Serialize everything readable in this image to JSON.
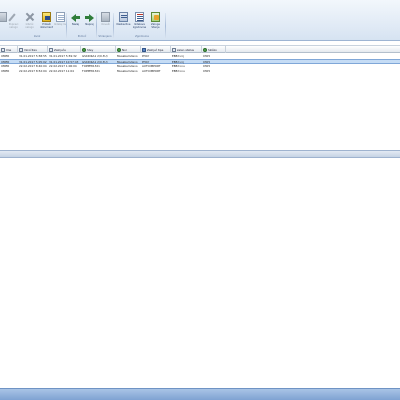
{
  "ribbon": {
    "buttons": [
      {
        "label": "",
        "icon": "edit-icon",
        "disabled": true
      },
      {
        "label": "Popravi nalogo",
        "icon": "pencil-icon",
        "disabled": true
      },
      {
        "label": "Izbriši nalogo",
        "icon": "delete-icon",
        "disabled": true
      },
      {
        "label": "Prikaži dokument",
        "icon": "show-document-icon",
        "disabled": false
      },
      {
        "label": "Izdelaj list",
        "icon": "create-list-icon",
        "disabled": true
      },
      {
        "label": "Nazaj",
        "icon": "back-arrow-icon",
        "disabled": false
      },
      {
        "label": "Naprej",
        "icon": "forward-arrow-icon",
        "disabled": false
      },
      {
        "label": "Osveži",
        "icon": "refresh-icon",
        "disabled": true
      },
      {
        "label": "Nastavitve",
        "icon": "settings-card-icon",
        "disabled": false
      },
      {
        "label": "Izdelava zgodovine",
        "icon": "history-list-icon",
        "disabled": false
      },
      {
        "label": "Zaloge Stanje",
        "icon": "stock-icon",
        "disabled": false
      }
    ],
    "groups": [
      {
        "label": "Izvoz"
      },
      {
        "label": "Pomoč"
      },
      {
        "label": "Shranjeno"
      },
      {
        "label": "Zgodovina"
      }
    ]
  },
  "grid": {
    "columns": [
      {
        "label": "Ime",
        "icon": "none"
      },
      {
        "label": "Vzročitev",
        "icon": "doc"
      },
      {
        "label": "Zaključe",
        "icon": "doc"
      },
      {
        "label": "Stey",
        "icon": "green"
      },
      {
        "label": "Nor",
        "icon": "green"
      },
      {
        "label": "Zaključ tipe",
        "icon": "blue"
      },
      {
        "label": "zelen status",
        "icon": "doc"
      },
      {
        "label": "Skiško",
        "icon": "green"
      }
    ],
    "rows": [
      {
        "cells": [
          "UMER",
          "31.01.2017 5:58:55",
          "31.01.2017 5:59:32",
          "GSKDIKA1 2(0.3U)",
          "Musabemdeno",
          "PHAY",
          "EBB:t.nij",
          "0305"
        ],
        "selected": false
      },
      {
        "cells": [
          "UMER",
          "31.01.2017 5:05:02",
          "31.01.2017 10:57:43",
          "GSKDIKA1 2(0.3U)",
          "Musabemdeno",
          "PHAY",
          "EBB:t.nij",
          "0305"
        ],
        "selected": true
      },
      {
        "cells": [
          "UMER",
          "22.02.2017 8:40:04",
          "22.02.2017 1:06:04",
          "TOPPE81321",
          "Musabemdeno",
          "AUTOIMPORT",
          "EBB:t.inu",
          "0305"
        ],
        "selected": false
      },
      {
        "cells": [
          "UMER",
          "22.02.2017 8:52:04",
          "22.02.2017 11:04",
          "TOPPE81321",
          "Musabemdeno",
          "AUTOIMPORT",
          "EBB:t.inu",
          "0305"
        ],
        "selected": false
      }
    ]
  },
  "colors": {
    "accent": "#7fa2d2",
    "selection": "#c5dcf5"
  }
}
